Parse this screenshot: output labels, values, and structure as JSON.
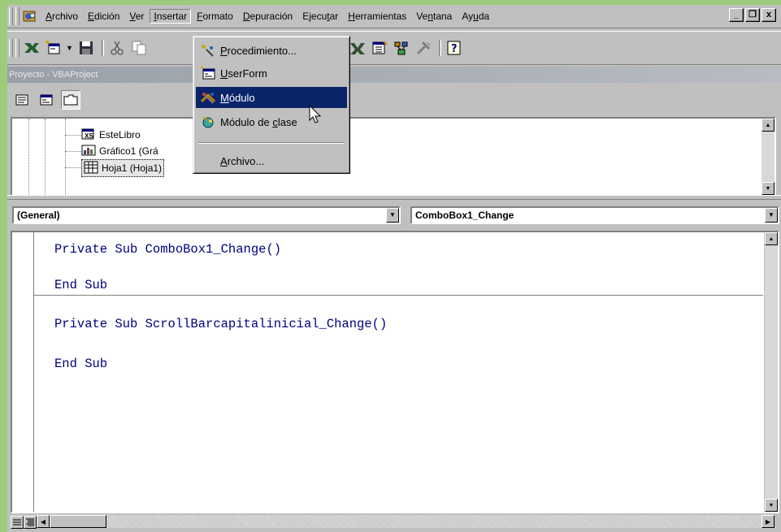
{
  "menubar": {
    "items": [
      {
        "label": "Archivo",
        "ul": "A",
        "rest": "rchivo"
      },
      {
        "label": "Edición",
        "ul": "E",
        "rest": "dición"
      },
      {
        "label": "Ver",
        "ul": "V",
        "rest": "er"
      },
      {
        "label": "Insertar",
        "ul": "I",
        "rest": "nsertar"
      },
      {
        "label": "Formato",
        "ul": "F",
        "rest": "ormato"
      },
      {
        "label": "Depuración",
        "ul": "D",
        "rest": "epuración"
      },
      {
        "label": "Ejecutar",
        "pre": "Ejecu",
        "ul": "t",
        "rest": "ar"
      },
      {
        "label": "Herramientas",
        "ul": "H",
        "rest": "erramientas"
      },
      {
        "label": "Ventana",
        "pre": "Ve",
        "ul": "n",
        "rest": "tana"
      },
      {
        "label": "Ayuda",
        "pre": "Ay",
        "ul": "u",
        "rest": "da"
      }
    ],
    "window_controls": {
      "minimize": "_",
      "restore": "❐",
      "close": "x"
    }
  },
  "project": {
    "title": "Proyecto - VBAProject",
    "tree": [
      {
        "label": "EsteLibro",
        "icon": "workbook-icon"
      },
      {
        "label": "Gráfico1 (Grá",
        "icon": "chart-sheet-icon"
      },
      {
        "label": "Hoja1 (Hoja1)",
        "icon": "worksheet-icon",
        "selected": true
      }
    ]
  },
  "insert_menu": {
    "items": [
      {
        "pre": "",
        "ul": "P",
        "rest": "rocedimiento...",
        "icon": "procedure-icon"
      },
      {
        "pre": "",
        "ul": "U",
        "rest": "serForm",
        "icon": "userform-icon"
      },
      {
        "pre": "",
        "ul": "M",
        "rest": "ódulo",
        "icon": "module-icon",
        "highlighted": true
      },
      {
        "pre": "Módulo de ",
        "ul": "c",
        "rest": "lase",
        "icon": "class-module-icon"
      },
      {
        "pre": "",
        "ul": "A",
        "rest": "rchivo...",
        "icon": ""
      }
    ]
  },
  "code_window": {
    "object_combo": "(General)",
    "procedure_combo": "ComboBox1_Change",
    "lines": [
      "Private Sub ComboBox1_Change()",
      "End Sub",
      "Private Sub ScrollBarcapitalinicial_Change()",
      "End Sub"
    ]
  },
  "colors": {
    "menu_highlight": "#0a246a",
    "code_keyword": "#000080",
    "face": "#c0c0c0",
    "desktop": "#9ccc7a"
  }
}
